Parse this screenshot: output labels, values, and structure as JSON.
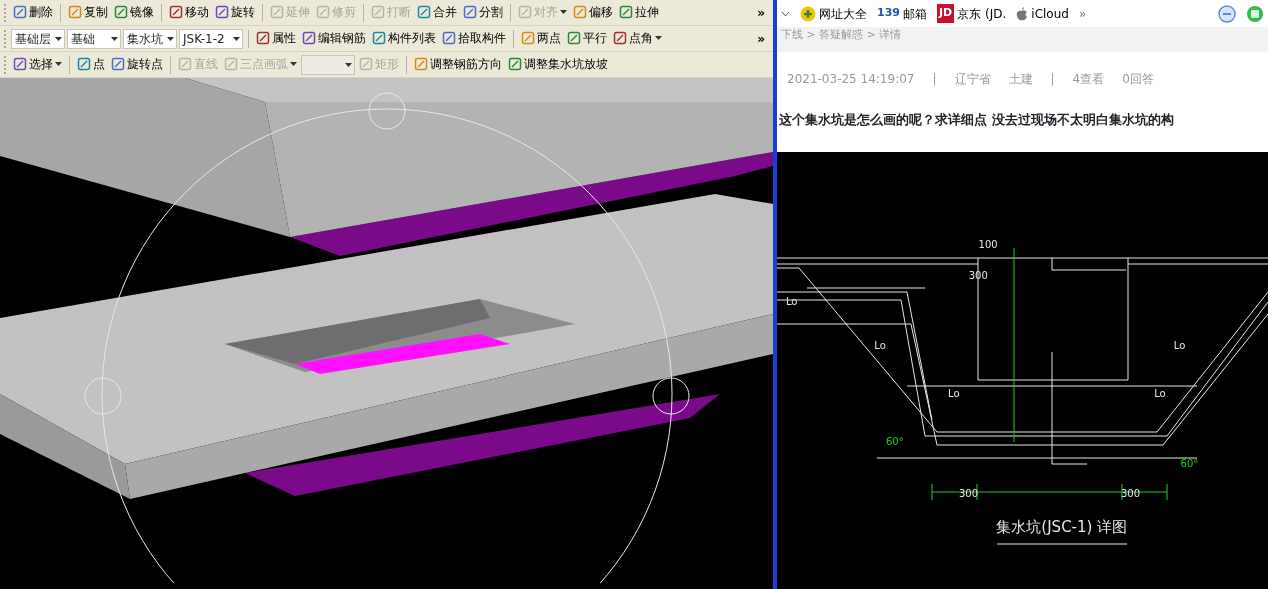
{
  "cad_app": {
    "toolbars": [
      {
        "items": [
          {
            "kind": "button",
            "label": "删除",
            "disabled": false
          },
          {
            "kind": "separator"
          },
          {
            "kind": "button",
            "label": "复制",
            "disabled": false
          },
          {
            "kind": "button",
            "label": "镜像",
            "disabled": false
          },
          {
            "kind": "separator"
          },
          {
            "kind": "button",
            "label": "移动",
            "disabled": false
          },
          {
            "kind": "button",
            "label": "旋转",
            "disabled": false
          },
          {
            "kind": "separator"
          },
          {
            "kind": "button",
            "label": "延伸",
            "disabled": true
          },
          {
            "kind": "button",
            "label": "修剪",
            "disabled": true
          },
          {
            "kind": "separator"
          },
          {
            "kind": "button",
            "label": "打断",
            "disabled": true
          },
          {
            "kind": "button",
            "label": "合并",
            "disabled": false
          },
          {
            "kind": "button",
            "label": "分割",
            "disabled": false
          },
          {
            "kind": "separator"
          },
          {
            "kind": "menu-button",
            "label": "对齐",
            "disabled": true
          },
          {
            "kind": "button",
            "label": "偏移",
            "disabled": false
          },
          {
            "kind": "button",
            "label": "拉伸",
            "disabled": false
          },
          {
            "kind": "overflow",
            "label": "»"
          }
        ]
      },
      {
        "items": [
          {
            "kind": "dropdown",
            "value": "基础层",
            "disabled": false
          },
          {
            "kind": "dropdown",
            "value": "基础",
            "disabled": false
          },
          {
            "kind": "dropdown",
            "value": "集水坑",
            "disabled": false
          },
          {
            "kind": "dropdown",
            "value": "JSK-1-2",
            "disabled": false
          },
          {
            "kind": "separator"
          },
          {
            "kind": "button",
            "label": "属性",
            "disabled": false
          },
          {
            "kind": "button",
            "label": "编辑钢筋",
            "disabled": false
          },
          {
            "kind": "button",
            "label": "构件列表",
            "disabled": false
          },
          {
            "kind": "button",
            "label": "拾取构件",
            "disabled": false
          },
          {
            "kind": "separator"
          },
          {
            "kind": "button",
            "label": "两点",
            "disabled": false
          },
          {
            "kind": "button",
            "label": "平行",
            "disabled": false
          },
          {
            "kind": "menu-button",
            "label": "点角",
            "disabled": false
          },
          {
            "kind": "overflow",
            "label": "»"
          }
        ]
      },
      {
        "items": [
          {
            "kind": "menu-button",
            "label": "选择",
            "disabled": false
          },
          {
            "kind": "separator"
          },
          {
            "kind": "button",
            "label": "点",
            "disabled": false
          },
          {
            "kind": "button",
            "label": "旋转点",
            "disabled": false
          },
          {
            "kind": "separator"
          },
          {
            "kind": "button",
            "label": "直线",
            "disabled": true
          },
          {
            "kind": "menu-button",
            "label": "三点画弧",
            "disabled": true
          },
          {
            "kind": "dropdown",
            "value": "",
            "disabled": true
          },
          {
            "kind": "button",
            "label": "矩形",
            "disabled": true
          },
          {
            "kind": "separator"
          },
          {
            "kind": "button",
            "label": "调整钢筋方向",
            "disabled": false
          },
          {
            "kind": "button",
            "label": "调整集水坑放坡",
            "disabled": false
          }
        ]
      }
    ]
  },
  "browser": {
    "bookmarks": [
      {
        "kind": "site",
        "label": "网址大全"
      },
      {
        "kind": "logo",
        "logo": "139",
        "label": "邮箱"
      },
      {
        "kind": "logo",
        "logo": "JD",
        "label": "京东 (JD."
      },
      {
        "kind": "site",
        "label": "iCloud"
      }
    ],
    "bookmarks_more": "»",
    "breadcrumb": "下线 > 答疑解惑 > 详情",
    "meta": [
      "2021-03-25 14:19:07",
      "|",
      "辽宁省",
      "土建",
      "|",
      "4查看",
      "0回答"
    ],
    "question_title": "这个集水坑是怎么画的呢？求详细点 没去过现场不太明白集水坑的构",
    "detail_drawing": {
      "labels": [
        {
          "kind": "dim",
          "text": "100"
        },
        {
          "kind": "dim",
          "text": "300"
        },
        {
          "kind": "dim",
          "text": "Lo"
        },
        {
          "kind": "dim",
          "text": "Lo"
        },
        {
          "kind": "dim",
          "text": "Lo"
        },
        {
          "kind": "dim",
          "text": "Lo"
        },
        {
          "kind": "dim",
          "text": "Lo"
        },
        {
          "kind": "angle",
          "text": "60°"
        },
        {
          "kind": "angle",
          "text": "60°"
        },
        {
          "kind": "dim",
          "text": "300"
        },
        {
          "kind": "dim",
          "text": "300"
        },
        {
          "kind": "title",
          "text": "集水坑(JSC-1) 详图"
        }
      ]
    }
  }
}
